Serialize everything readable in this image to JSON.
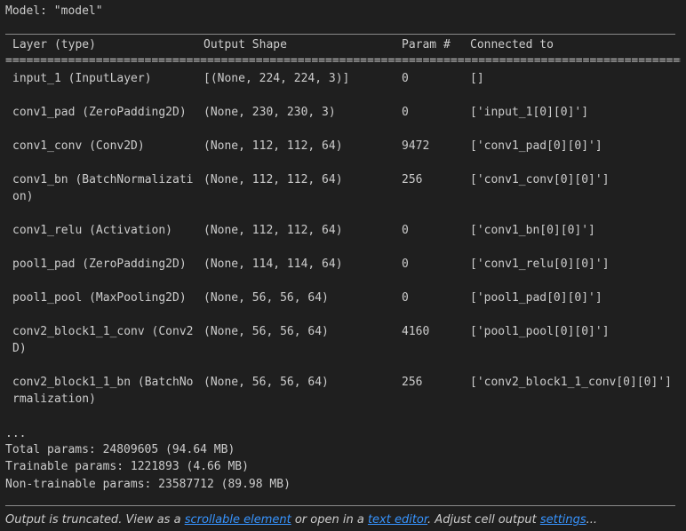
{
  "model_line": "Model: \"model\"",
  "headers": {
    "layer": "Layer (type)",
    "output_shape": "Output Shape",
    "params": "Param #",
    "connected": "Connected to"
  },
  "separator": "===========================================================================================================",
  "rows": [
    {
      "layer_line1": "input_1 (InputLayer)",
      "layer_line2": "",
      "shape": "[(None, 224, 224, 3)]",
      "params": "0",
      "connected": "[]"
    },
    {
      "layer_line1": "conv1_pad (ZeroPadding2D)",
      "layer_line2": "",
      "shape": "(None, 230, 230, 3)",
      "params": "0",
      "connected": "['input_1[0][0]']"
    },
    {
      "layer_line1": "conv1_conv (Conv2D)",
      "layer_line2": "",
      "shape": "(None, 112, 112, 64)",
      "params": "9472",
      "connected": "['conv1_pad[0][0]']"
    },
    {
      "layer_line1": "conv1_bn (BatchNormalizati",
      "layer_line2": "on)",
      "shape": "(None, 112, 112, 64)",
      "params": "256",
      "connected": "['conv1_conv[0][0]']"
    },
    {
      "layer_line1": "conv1_relu (Activation)",
      "layer_line2": "",
      "shape": "(None, 112, 112, 64)",
      "params": "0",
      "connected": "['conv1_bn[0][0]']"
    },
    {
      "layer_line1": "pool1_pad (ZeroPadding2D)",
      "layer_line2": "",
      "shape": "(None, 114, 114, 64)",
      "params": "0",
      "connected": "['conv1_relu[0][0]']"
    },
    {
      "layer_line1": "pool1_pool (MaxPooling2D)",
      "layer_line2": "",
      "shape": "(None, 56, 56, 64)",
      "params": "0",
      "connected": "['pool1_pad[0][0]']"
    },
    {
      "layer_line1": "conv2_block1_1_conv (Conv2",
      "layer_line2": "D)",
      "shape": "(None, 56, 56, 64)",
      "params": "4160",
      "connected": "['pool1_pool[0][0]']"
    },
    {
      "layer_line1": "conv2_block1_1_bn (BatchNo",
      "layer_line2": "rmalization)",
      "shape": "(None, 56, 56, 64)",
      "params": "256",
      "connected": "['conv2_block1_1_conv[0][0]']"
    }
  ],
  "ellipsis": "...",
  "totals": {
    "total": "Total params: 24809605 (94.64 MB)",
    "trainable": "Trainable params: 1221893 (4.66 MB)",
    "non_trainable": "Non-trainable params: 23587712 (89.98 MB)"
  },
  "notice": {
    "prefix": "Output is truncated. View as a ",
    "link1": "scrollable element",
    "middle": " or open in a ",
    "link2": "text editor",
    "suffix": ". Adjust cell output ",
    "link3": "settings",
    "end": "..."
  }
}
